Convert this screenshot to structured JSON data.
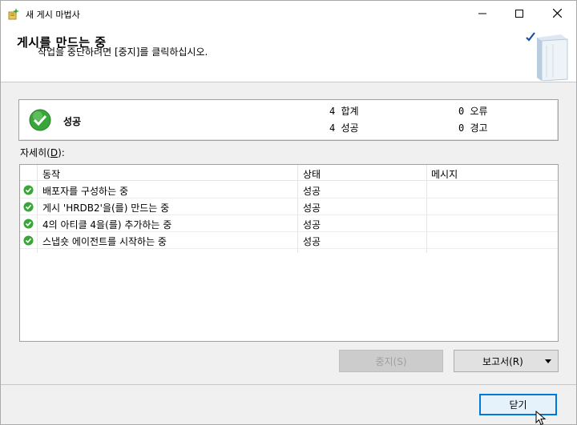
{
  "window": {
    "title": "새 게시 마법사"
  },
  "header": {
    "title": "게시를 만드는 중",
    "subtitle": "작업을 중단하려면 [중지]를 클릭하십시오."
  },
  "summary": {
    "status": "성공",
    "total": "4 합계",
    "success": "4 성공",
    "errors": "0 오류",
    "warnings": "0 경고"
  },
  "details": {
    "label_pre": "자세히(",
    "label_key": "D",
    "label_post": "):",
    "columns": [
      "동작",
      "상태",
      "메시지"
    ],
    "rows": [
      {
        "action": "배포자를 구성하는 중",
        "state": "성공",
        "message": ""
      },
      {
        "action": "게시 'HRDB2'을(를) 만드는 중",
        "state": "성공",
        "message": ""
      },
      {
        "action": "4의 아티클 4을(를) 추가하는 중",
        "state": "성공",
        "message": ""
      },
      {
        "action": "스냅숏 에이전트를 시작하는 중",
        "state": "성공",
        "message": ""
      }
    ]
  },
  "buttons": {
    "stop": "중지(S)",
    "report": "보고서(R)",
    "close": "닫기"
  },
  "colors": {
    "success_green": "#3aa63a",
    "accent_blue": "#0078d7"
  },
  "icons": {
    "app": "wizard-icon",
    "summary_status": "success-check-icon",
    "row_status": "success-check-icon",
    "header_art": "book-check-icon"
  }
}
